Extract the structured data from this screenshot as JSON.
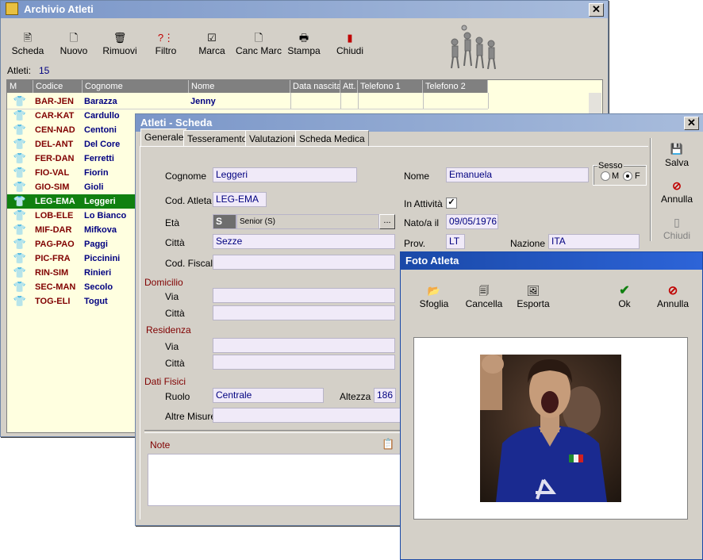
{
  "main_window": {
    "title": "Archivio Atleti",
    "toolbar": [
      {
        "label": "Scheda",
        "icon": "🖹"
      },
      {
        "label": "Nuovo",
        "icon": "🗋"
      },
      {
        "label": "Rimuovi",
        "icon": "🗑"
      },
      {
        "label": "Filtro",
        "icon": "?⋮"
      },
      {
        "label": "Marca",
        "icon": "☑"
      },
      {
        "label": "Canc Marc",
        "icon": "🗋"
      },
      {
        "label": "Stampa",
        "icon": "🖶"
      },
      {
        "label": "Chiudi",
        "icon": "▮"
      }
    ],
    "count_label": "Atleti:",
    "count_value": "15",
    "columns": [
      "M",
      "Codice",
      "Cognome",
      "Nome",
      "Data nascita",
      "Att.",
      "Telefono 1",
      "Telefono 2"
    ],
    "rows": [
      {
        "code": "BAR-JEN",
        "surname": "Barazza",
        "name": "Jenny"
      },
      {
        "code": "CAR-KAT",
        "surname": "Cardullo",
        "name": ""
      },
      {
        "code": "CEN-NAD",
        "surname": "Centoni",
        "name": ""
      },
      {
        "code": "DEL-ANT",
        "surname": "Del Core",
        "name": ""
      },
      {
        "code": "FER-DAN",
        "surname": "Ferretti",
        "name": ""
      },
      {
        "code": "FIO-VAL",
        "surname": "Fiorin",
        "name": ""
      },
      {
        "code": "GIO-SIM",
        "surname": "Gioli",
        "name": ""
      },
      {
        "code": "LEG-EMA",
        "surname": "Leggeri",
        "name": ""
      },
      {
        "code": "LOB-ELE",
        "surname": "Lo Bianco",
        "name": ""
      },
      {
        "code": "MIF-DAR",
        "surname": "Mifkova",
        "name": ""
      },
      {
        "code": "PAG-PAO",
        "surname": "Paggi",
        "name": ""
      },
      {
        "code": "PIC-FRA",
        "surname": "Piccinini",
        "name": ""
      },
      {
        "code": "RIN-SIM",
        "surname": "Rinieri",
        "name": ""
      },
      {
        "code": "SEC-MAN",
        "surname": "Secolo",
        "name": ""
      },
      {
        "code": "TOG-ELI",
        "surname": "Togut",
        "name": ""
      }
    ],
    "row_icon": "👕"
  },
  "scheda": {
    "title": "Atleti - Scheda",
    "tabs": [
      "Generale",
      "Tesseramento",
      "Valutazioni",
      "Scheda Medica"
    ],
    "labels": {
      "cognome": "Cognome",
      "cod_atleta": "Cod. Atleta",
      "eta": "Età",
      "citta": "Città",
      "cod_fiscale": "Cod. Fiscale",
      "domicilio": "Domicilio",
      "via": "Via",
      "citta2": "Città",
      "residenza": "Residenza",
      "via2": "Via",
      "citta3": "Città",
      "dati_fisici": "Dati Fisici",
      "ruolo": "Ruolo",
      "altezza": "Altezza",
      "altre_misure": "Altre Misure",
      "note": "Note",
      "nome": "Nome",
      "sesso": "Sesso",
      "m": "M",
      "f": "F",
      "in_attivita": "In Attività",
      "nato_il": "Nato/a il",
      "prov": "Prov.",
      "nazione": "Nazione"
    },
    "values": {
      "cognome": "Leggeri",
      "cod_atleta": "LEG-EMA",
      "eta_code": "S",
      "eta_desc": "Senior (S)",
      "citta": "Sezze",
      "ruolo": "Centrale",
      "altezza": "186",
      "nome": "Emanuela",
      "nato_il": "09/05/1976",
      "prov": "LT",
      "nazione": "ITA",
      "ellipsis": "..."
    },
    "side_buttons": [
      {
        "label": "Salva",
        "icon": "💾"
      },
      {
        "label": "Annulla",
        "icon": "⊘"
      },
      {
        "label": "Chiudi",
        "icon": "▯"
      }
    ]
  },
  "foto": {
    "title": "Foto Atleta",
    "toolbar": [
      {
        "label": "Sfoglia",
        "icon": "📂"
      },
      {
        "label": "Cancella",
        "icon": "🗐"
      },
      {
        "label": "Esporta",
        "icon": "🖼"
      }
    ],
    "ok": {
      "label": "Ok",
      "icon": "✔"
    },
    "annulla": {
      "label": "Annulla",
      "icon": "⊘"
    }
  },
  "colors": {
    "selected_row": "#108010",
    "title_active": "#1a49a8",
    "grid_bg": "#ffffe0"
  }
}
